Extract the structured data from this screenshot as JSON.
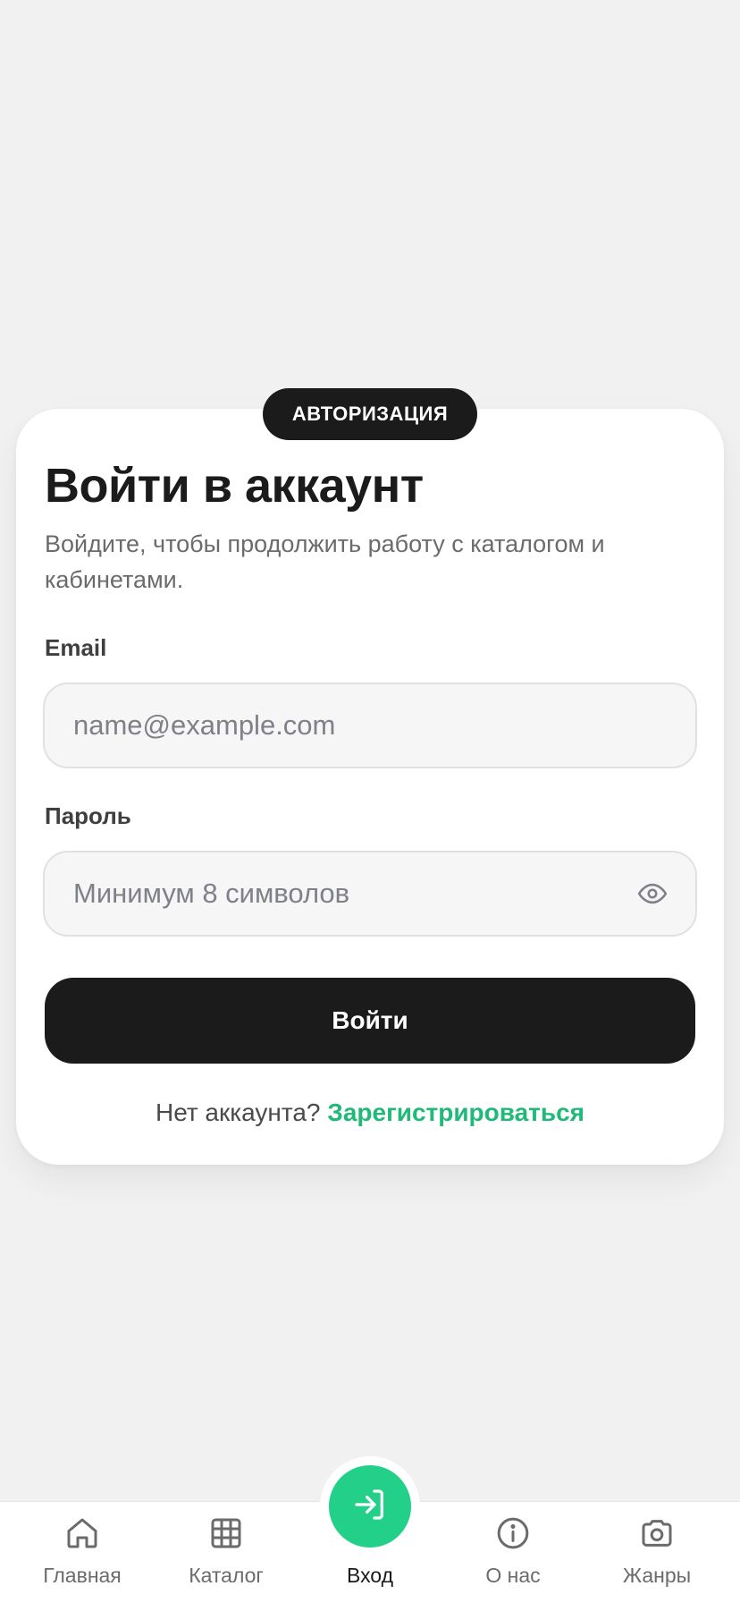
{
  "badge": "АВТОРИЗАЦИЯ",
  "title": "Войти в аккаунт",
  "subtitle": "Войдите, чтобы продолжить работу с каталогом и кабинетами.",
  "email": {
    "label": "Email",
    "placeholder": "name@example.com"
  },
  "password": {
    "label": "Пароль",
    "placeholder": "Минимум 8 символов",
    "toggle_icon": "eye-icon"
  },
  "submit_label": "Войти",
  "register": {
    "prompt": "Нет аккаунта?",
    "link": "Зарегистрироваться"
  },
  "colors": {
    "accent": "#21b979",
    "dark": "#1b1b1b",
    "background": "#f1f1f2"
  },
  "nav": {
    "items": [
      {
        "label": "Главная",
        "icon": "home-icon"
      },
      {
        "label": "Каталог",
        "icon": "grid-icon"
      },
      {
        "label": "Вход",
        "icon": "login-icon",
        "active": true
      },
      {
        "label": "О нас",
        "icon": "info-icon"
      },
      {
        "label": "Жанры",
        "icon": "camera-icon"
      }
    ]
  }
}
